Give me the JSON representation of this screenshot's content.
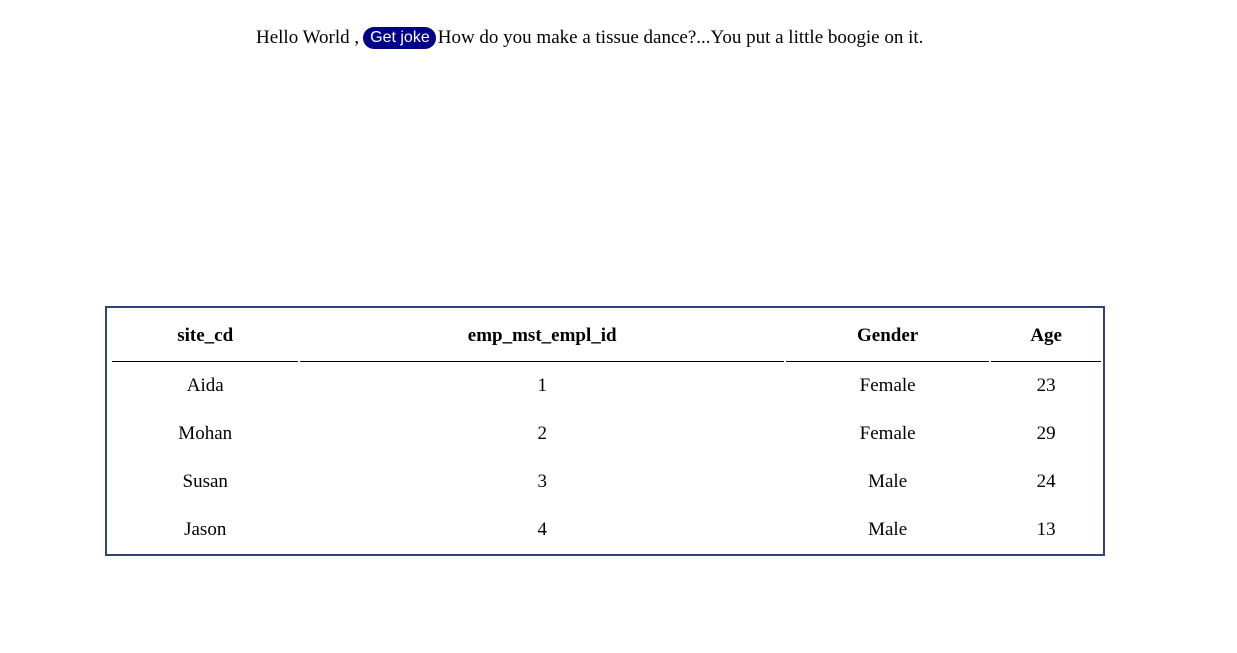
{
  "header": {
    "greeting": "Hello World ,",
    "joke_button_label": "Get joke",
    "joke_text": "How do you make a tissue dance?...You put a little boogie on it."
  },
  "table": {
    "columns": [
      "site_cd",
      "emp_mst_empl_id",
      "Gender",
      "Age"
    ],
    "rows": [
      [
        "Aida",
        "1",
        "Female",
        "23"
      ],
      [
        "Mohan",
        "2",
        "Female",
        "29"
      ],
      [
        "Susan",
        "3",
        "Male",
        "24"
      ],
      [
        "Jason",
        "4",
        "Male",
        "13"
      ]
    ]
  },
  "colors": {
    "button_bg": "#00008b",
    "button_text": "#ffffff",
    "table_border": "#2d4577"
  }
}
